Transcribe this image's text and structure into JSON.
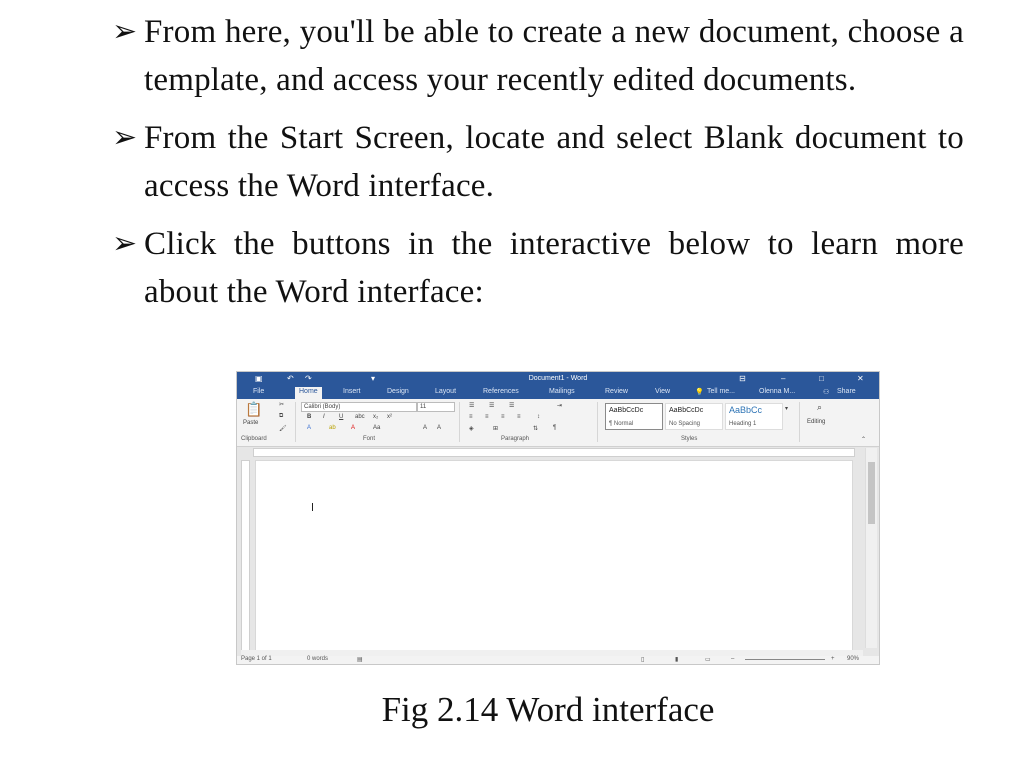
{
  "bullets": [
    {
      "marker": "➢",
      "text": "From here, you'll be able to create a new document, choose a template, and access your recently edited documents."
    },
    {
      "marker": "➢",
      "text": "From the Start Screen, locate and select Blank document to access the Word interface."
    },
    {
      "marker": "➢",
      "text": "Click the buttons in the interactive below to learn more about the Word interface:"
    }
  ],
  "word_ui": {
    "window_title": "Document1 - Word",
    "tabs": [
      "File",
      "Home",
      "Insert",
      "Design",
      "Layout",
      "References",
      "Mailings",
      "Review",
      "View"
    ],
    "active_tab": "Home",
    "tell_me": "Tell me...",
    "user": "Olenna M...",
    "share": "Share",
    "font_name": "Calibri (Body)",
    "font_size": "11",
    "paste": "Paste",
    "styles": [
      {
        "sample": "AaBbCcDc",
        "name": "¶ Normal"
      },
      {
        "sample": "AaBbCcDc",
        "name": "No Spacing"
      },
      {
        "sample": "AaBbCc",
        "name": "Heading 1"
      }
    ],
    "editing": "Editing",
    "groups": [
      "Clipboard",
      "Font",
      "Paragraph",
      "Styles"
    ],
    "status": {
      "page": "Page 1 of 1",
      "words": "0 words",
      "zoom": "90%"
    },
    "colors": {
      "title_bar": "#2b579a",
      "ribbon": "#f3f3f3"
    }
  },
  "caption": "Fig 2.14 Word interface"
}
